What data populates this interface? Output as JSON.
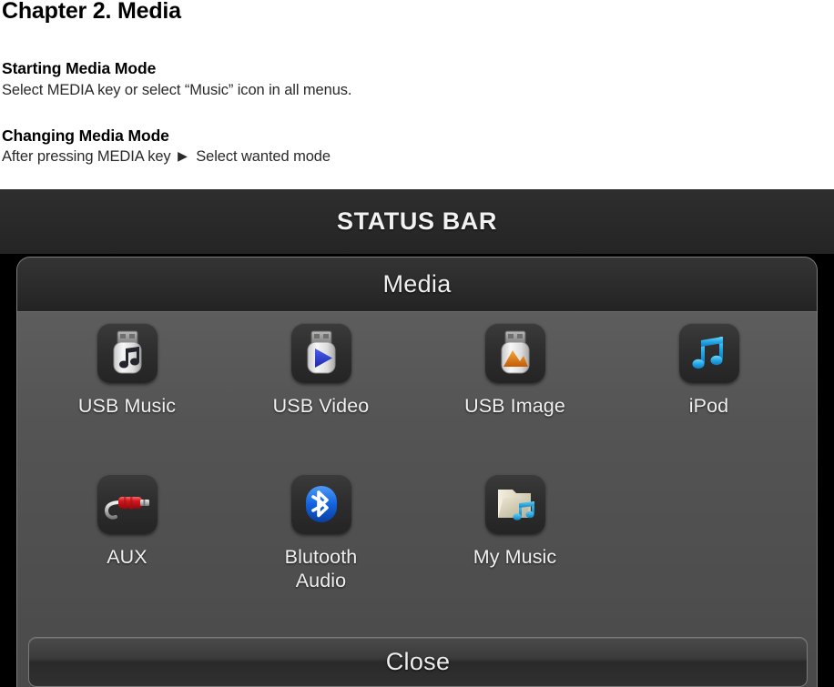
{
  "document": {
    "chapter_title": "Chapter 2. Media",
    "sections": [
      {
        "heading": "Starting Media Mode",
        "body": "Select MEDIA key or select “Music” icon in all menus."
      },
      {
        "heading": "Changing Media Mode",
        "body_before": "After pressing MEDIA key",
        "arrow": "▶",
        "body_after": "Select wanted mode"
      }
    ]
  },
  "screen": {
    "status_bar": {
      "label": "STATUS BAR"
    },
    "dialog": {
      "title": "Media",
      "items": [
        {
          "label": "USB Music",
          "icon": "usb-music-icon",
          "accent": "#2b2b33"
        },
        {
          "label": "USB Video",
          "icon": "usb-video-icon",
          "accent": "#2f45d8"
        },
        {
          "label": "USB Image",
          "icon": "usb-image-icon",
          "accent": "#e07818"
        },
        {
          "label": "iPod",
          "icon": "ipod-note-icon",
          "accent": "#29b6ec"
        },
        {
          "label": "AUX",
          "icon": "aux-jack-icon",
          "accent": "#d81f26"
        },
        {
          "label": "Blutooth\nAudio",
          "icon": "bluetooth-icon",
          "accent": "#1565e0"
        },
        {
          "label": "My Music",
          "icon": "my-music-folder-icon",
          "accent": "#29a8e0"
        }
      ],
      "close_label": "Close"
    }
  },
  "colors": {
    "screen_background": "#000000",
    "status_bar_background": "#2b2b2b",
    "dialog_header_background": "#2c2c2c",
    "dialog_body_background": "#535353",
    "label_text": "#f0f0f0"
  }
}
